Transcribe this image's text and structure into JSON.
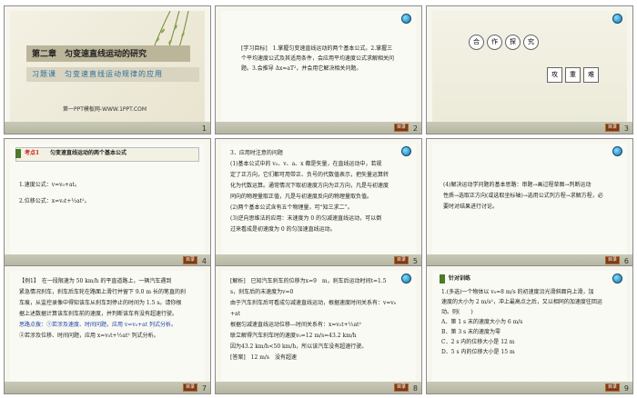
{
  "slides": [
    {
      "num": "1",
      "foot_left": "",
      "title": "第二章　匀变速直线运动的研究",
      "subtitle": "习题课　匀变速直线运动规律的应用",
      "url": "第一PPT模板网-WWW.1PPT.COM"
    },
    {
      "num": "2",
      "foot_left": "",
      "btn": "目录",
      "lines": [
        "[学习目标]　1.掌握匀变速直线运动的两个基本公式。2.掌握三",
        "个平均速度公式及其适用条件，会应用平均速度公式求解相关问",
        "题。3.会推导 Δx=aT²，并会用它解决相关问题。"
      ]
    },
    {
      "num": "3",
      "foot_left": "",
      "btn": "目录",
      "words_top": [
        "合",
        "作",
        "探",
        "究"
      ],
      "words_bottom": [
        "攻",
        "重",
        "难"
      ]
    },
    {
      "num": "4",
      "foot_left": "",
      "btn": "目录",
      "tag": "考点1",
      "heading": "匀变速直线运动的两个基本公式",
      "lines": [
        "1.速度公式：v=v₀+at。",
        "2.位移公式：x=v₀t+½at²。"
      ]
    },
    {
      "num": "5",
      "foot_left": "",
      "btn": "目录",
      "lines": [
        "3．应用时注意的问题",
        "(1)基本公式中的 v₀、v、a、x 都是矢量，在直线运动中，若规",
        "定了正方向，它们都可用带正、负号的代数值表示，把矢量运算转",
        "化为代数运算。通常情况下取初速度方向为正方向，凡是与初速度",
        "同向的物理量取正值，凡是与初速度反向的物理量取负值。",
        "(2)两个基本公式含有五个物理量，可“知三求二”。",
        "(3)逆向思维法的应用：末速度为 0 的匀减速直线运动，可以倒",
        "过来看成是初速度为 0 的匀加速直线运动。"
      ]
    },
    {
      "num": "6",
      "foot_left": "",
      "btn": "目录",
      "lines": [
        "(4)解决运动学问题的基本思路：审题→画过程草图→判断运动",
        "性质→选取正方向(或选取坐标轴)→选用公式列方程→求解方程，必",
        "要时对结果进行讨论。"
      ]
    },
    {
      "num": "7",
      "foot_left": "",
      "btn": "目录",
      "lines": [
        "【例1】　在一段限速为 50 km/h 的平直道路上，一辆汽车遇到",
        "紧急情况刹车，刹车后车轮在路面上滑行并留下 9.0 m 长的笔直的刹",
        "车痕，从监控录像中得知该车从刹车到停止的时间为 1.5 s。请你根",
        "据上述数据计算该车刹车前的速度，并判断该车有没有超速行驶。",
        "思路点拨：①若涉及速度、时间问题，应用 v=v₀+at 列式分析。",
        "②若涉及位移、时间问题，应用 x=v₀t+½at² 列式分析。"
      ],
      "hint_label": "思路点拨"
    },
    {
      "num": "8",
      "foot_left": "",
      "btn": "目录",
      "lines": [
        "[解析]　已知汽车刹车的位移为x=9　m，刹车后运动时间t=1.5",
        "s，刹车后的末速度为v=0",
        "由于汽车刹车后可看成匀减速直线运动，根据速度时间关系有：v=v₀",
        "+at",
        "根据匀减速直线运动位移—时间关系有：x=v₀t+½at²",
        "联立解得汽车刹车时的速度v₀=12 m/s=43.2 km/h",
        "因为43.2 km/h<50 km/h，所以该汽车没有超速行驶。",
        "[答案]　12 m/s　没有超速"
      ],
      "analysis_label": "[解析]",
      "answer_label": "[答案]"
    },
    {
      "num": "9",
      "foot_left": "",
      "btn": "目录",
      "tag": "针对训练",
      "lines": [
        "1.(多选)一个物体以 v₀=8 m/s 的初速度沿光滑斜面向上滑，加",
        "速度的大小为 2 m/s²，冲上最高点之后，又以相同的加速度往回运",
        "动。则(　　)",
        "A．第 1 s 末的速度大小为 6 m/s",
        "B．第 3 s 末的速度为零",
        "C．2 s 内的位移大小是 12 m",
        "D．5 s 内的位移大小是 15 m"
      ]
    }
  ],
  "colors": {
    "accent_red": "#c8211a",
    "accent_blue": "#1d3fa6",
    "footer": "#bdbda8",
    "button": "#7a3a16"
  }
}
